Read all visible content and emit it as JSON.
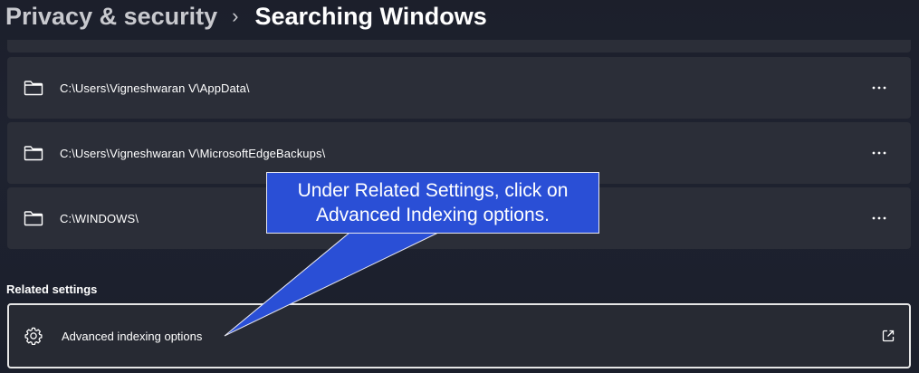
{
  "breadcrumb": {
    "parent": "Privacy & security",
    "separator": "›",
    "current": "Searching Windows"
  },
  "excluded_folders": [
    {
      "path": "C:\\Users\\Vigneshwaran V\\AppData\\",
      "icon": "folder-icon",
      "more_icon": "more-options-icon"
    },
    {
      "path": "C:\\Users\\Vigneshwaran V\\MicrosoftEdgeBackups\\",
      "icon": "folder-icon",
      "more_icon": "more-options-icon"
    },
    {
      "path": "C:\\WINDOWS\\",
      "icon": "folder-icon",
      "more_icon": "more-options-icon"
    }
  ],
  "related_settings": {
    "title": "Related settings",
    "items": [
      {
        "label": "Advanced indexing options",
        "icon": "gear-icon",
        "trailing_icon": "external-link-icon"
      }
    ]
  },
  "callout": {
    "line1": "Under Related Settings, click on",
    "line2": "Advanced Indexing options.",
    "color": "#2a4fd6"
  },
  "colors": {
    "background": "#1e2230",
    "card": "#2b2e38",
    "highlight_border": "#e6e6e6"
  }
}
